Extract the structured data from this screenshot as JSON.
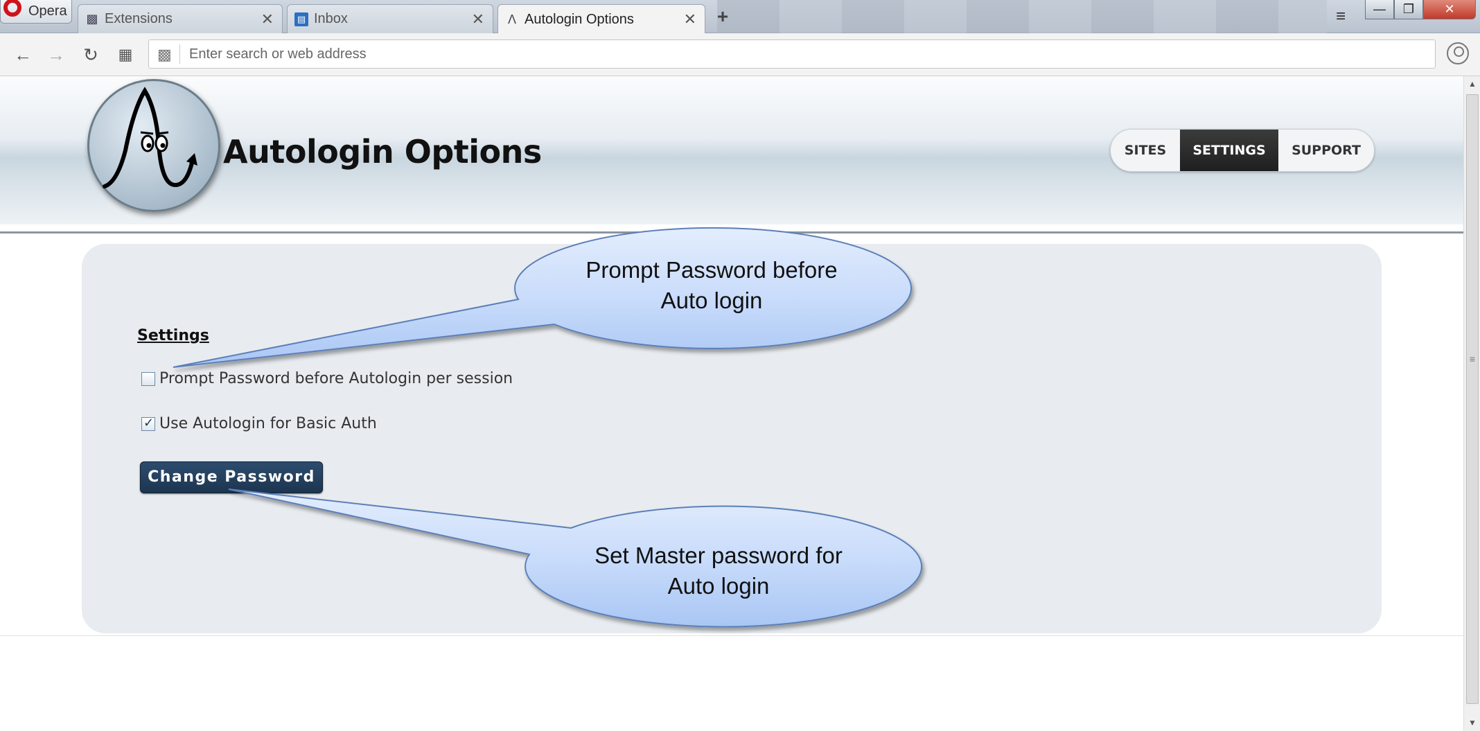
{
  "browser": {
    "opera_button_label": "Opera",
    "tabs": [
      {
        "label": "Extensions",
        "icon": "puzzle-icon",
        "active": false
      },
      {
        "label": "Inbox",
        "icon": "inbox-icon",
        "active": false
      },
      {
        "label": "Autologin Options",
        "icon": "autologin-icon",
        "active": true
      }
    ],
    "address_placeholder": "Enter search or web address"
  },
  "page": {
    "title": "Autologin Options",
    "nav": {
      "sites": "SITES",
      "settings": "SETTINGS",
      "support": "SUPPORT",
      "active": "SETTINGS"
    },
    "settings": {
      "heading": "Settings",
      "prompt_password_label": "Prompt Password before Autologin per session",
      "prompt_password_checked": false,
      "basic_auth_label": "Use Autologin for Basic Auth",
      "basic_auth_checked": true,
      "change_password_label": "Change Password"
    },
    "callouts": [
      {
        "line1": "Prompt Password before",
        "line2": "Auto login"
      },
      {
        "line1": "Set Master password for",
        "line2": "Auto login"
      }
    ]
  },
  "colors": {
    "nav_active": "#2a2a2a",
    "button_bg": "#1f3a57",
    "callout_fill": "#c9dcfb",
    "callout_stroke": "#5b7fb8",
    "card_bg": "#e8ecf0"
  }
}
